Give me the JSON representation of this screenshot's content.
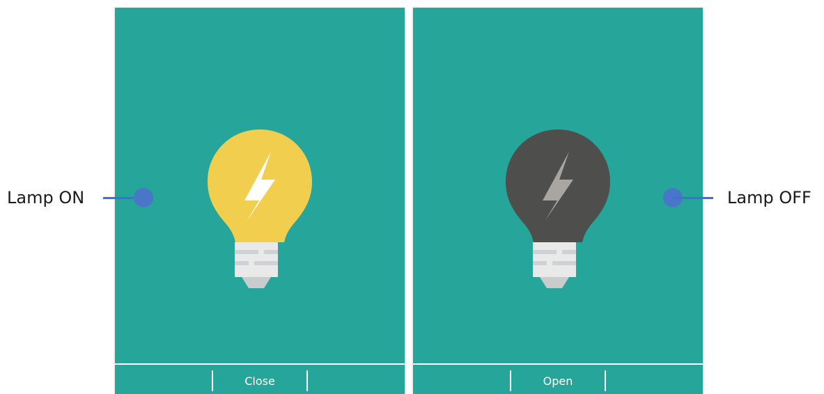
{
  "panels": [
    {
      "id": "lamp-on",
      "state": "on",
      "action_label": "Close",
      "colors": {
        "bulb": "#f2ce4f",
        "bolt": "#ffffff",
        "base": "#e9e9e9",
        "base_stripe": "#cfd2d3",
        "tip": "#c9cccd"
      }
    },
    {
      "id": "lamp-off",
      "state": "off",
      "action_label": "Open",
      "colors": {
        "bulb": "#4e4e4c",
        "bolt": "#a9a6a2",
        "base": "#e9e9e9",
        "base_stripe": "#cfd2d3",
        "tip": "#c9cccd"
      }
    }
  ],
  "callouts": {
    "on_label": "Lamp ON",
    "off_label": "Lamp OFF"
  },
  "colors": {
    "panel_background": "#26a69a",
    "callout_line": "#3f6fd1",
    "callout_dot": "#4a76c9"
  }
}
